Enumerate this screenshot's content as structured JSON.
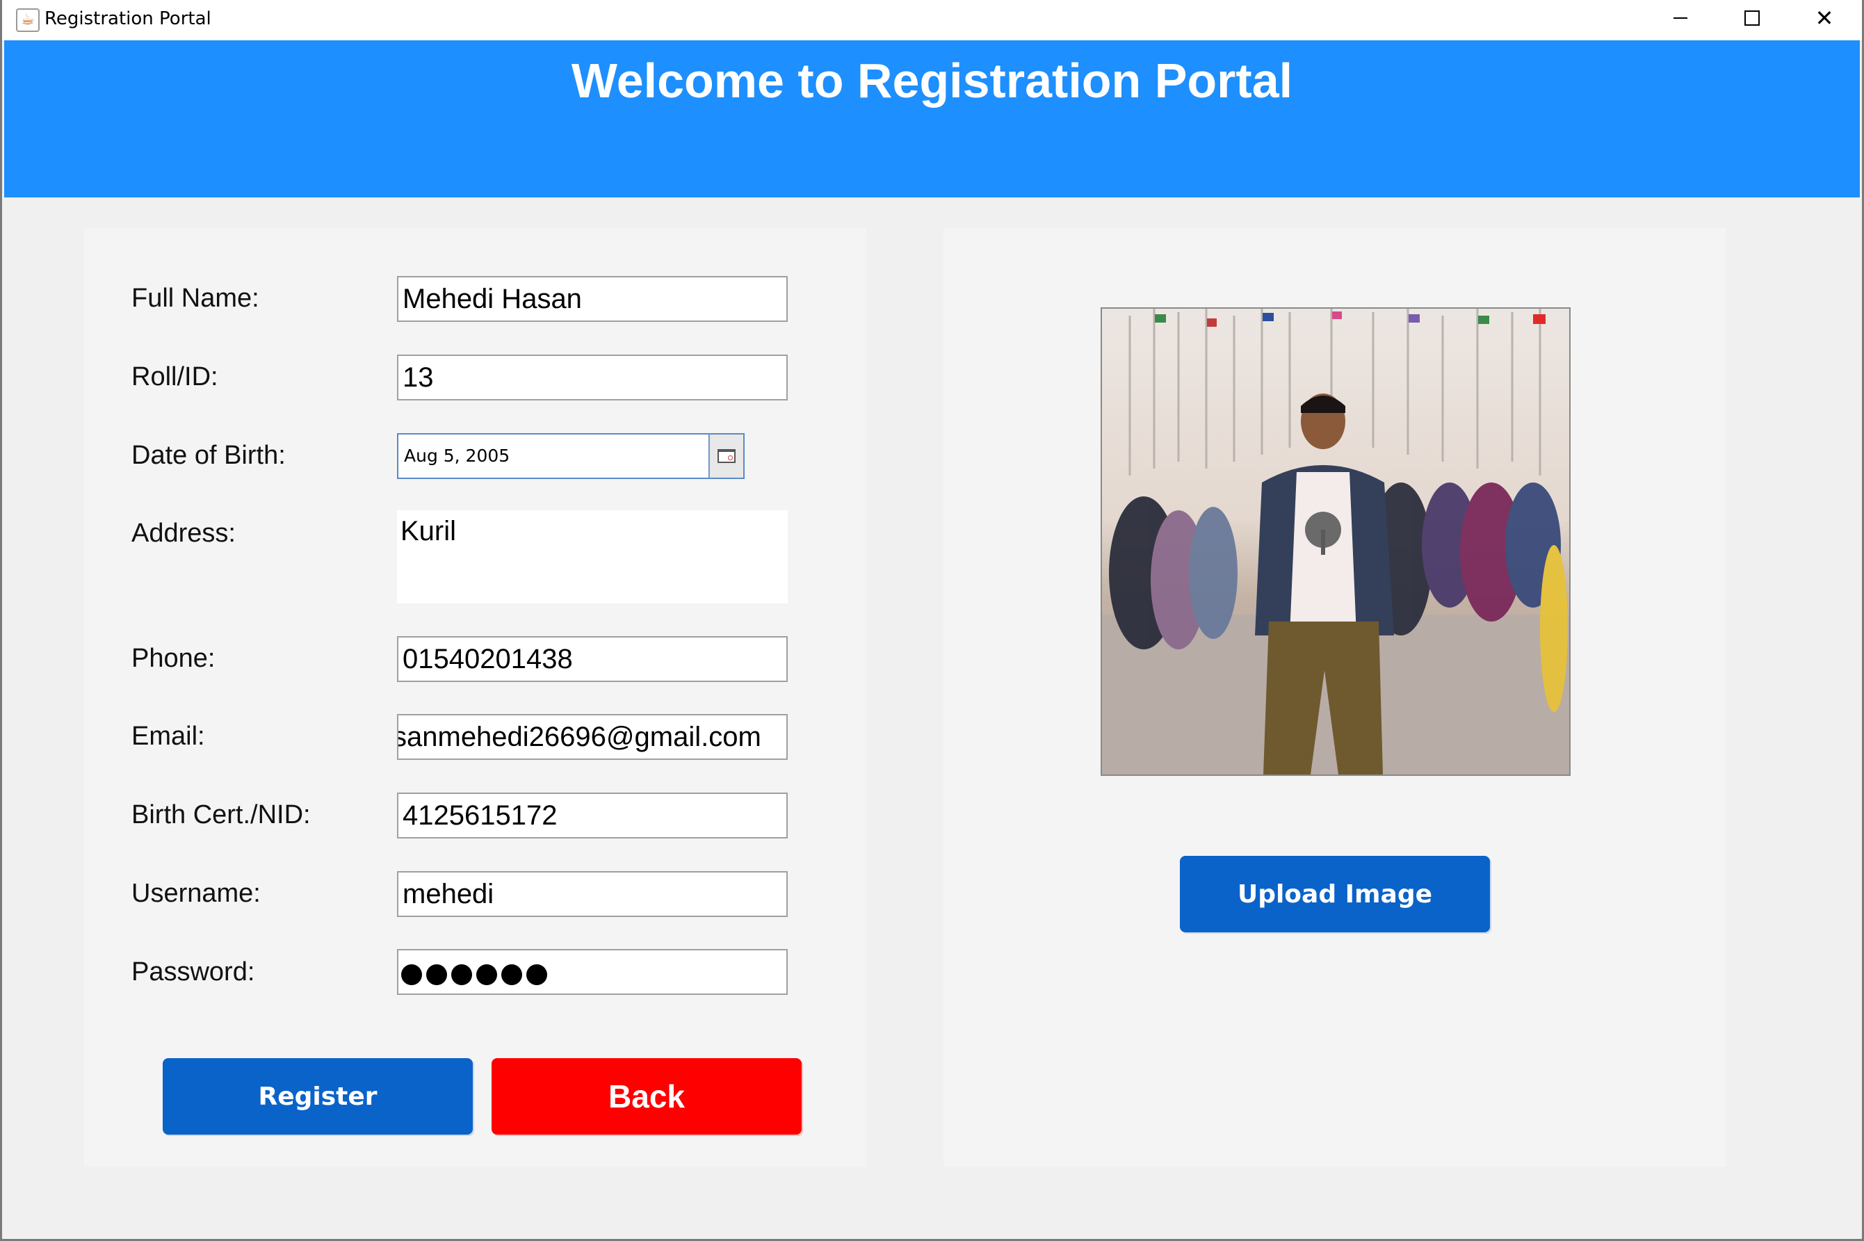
{
  "window": {
    "title": "Registration Portal",
    "controls": {
      "minimize": "minimize",
      "maximize": "maximize",
      "close": "✕"
    }
  },
  "header": {
    "title": "Welcome to Registration Portal",
    "bg_color": "#1e8ffe"
  },
  "form": {
    "full_name": {
      "label": "Full Name:",
      "value": "Mehedi Hasan"
    },
    "roll_id": {
      "label": "Roll/ID:",
      "value": "13"
    },
    "dob": {
      "label": "Date of Birth:",
      "value": "Aug 5, 2005"
    },
    "address": {
      "label": "Address:",
      "value": "Kuril"
    },
    "phone": {
      "label": "Phone:",
      "value": "01540201438"
    },
    "email": {
      "label": "Email:",
      "value": "sanmehedi26696@gmail.com"
    },
    "nid": {
      "label": "Birth Cert./NID:",
      "value": "4125615172"
    },
    "username": {
      "label": "Username:",
      "value": "mehedi"
    },
    "password": {
      "label": "Password:",
      "masked_length": 6
    }
  },
  "buttons": {
    "register": "Register",
    "back": "Back",
    "upload": "Upload Image"
  },
  "colors": {
    "primary_button": "#0a63c9",
    "danger_button": "#ff0000",
    "panel_bg": "#f4f4f4",
    "window_bg": "#f0f0f0"
  },
  "icons": {
    "app": "java-app-icon",
    "calendar": "calendar-icon"
  }
}
